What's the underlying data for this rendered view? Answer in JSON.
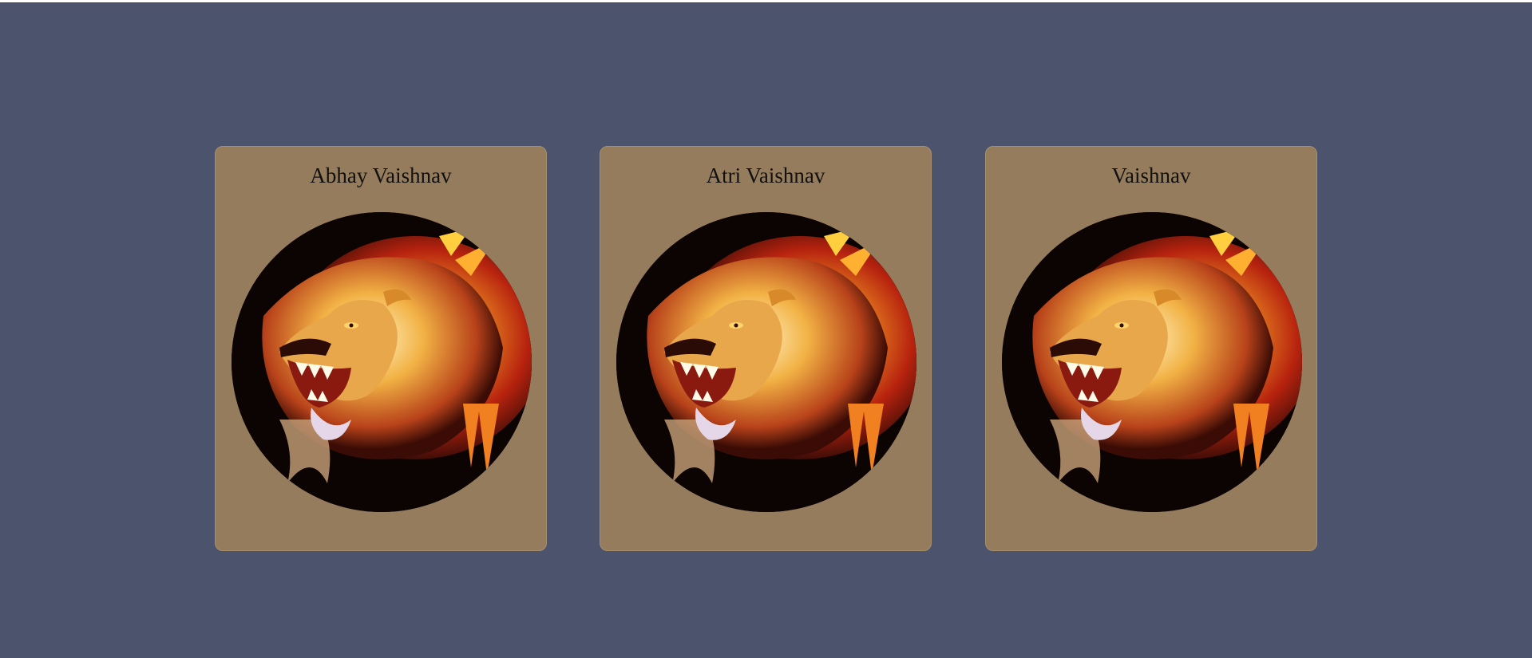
{
  "cards": [
    {
      "name": "Abhay Vaishnav",
      "image_alt": "roaring lion artwork",
      "image_icon": "lion-icon"
    },
    {
      "name": "Atri Vaishnav",
      "image_alt": "roaring lion artwork",
      "image_icon": "lion-icon"
    },
    {
      "name": "Vaishnav",
      "image_alt": "roaring lion artwork",
      "image_icon": "lion-icon"
    }
  ],
  "colors": {
    "page_background": "#4b536d",
    "card_background": "#957c5c",
    "title_text": "#111111"
  }
}
